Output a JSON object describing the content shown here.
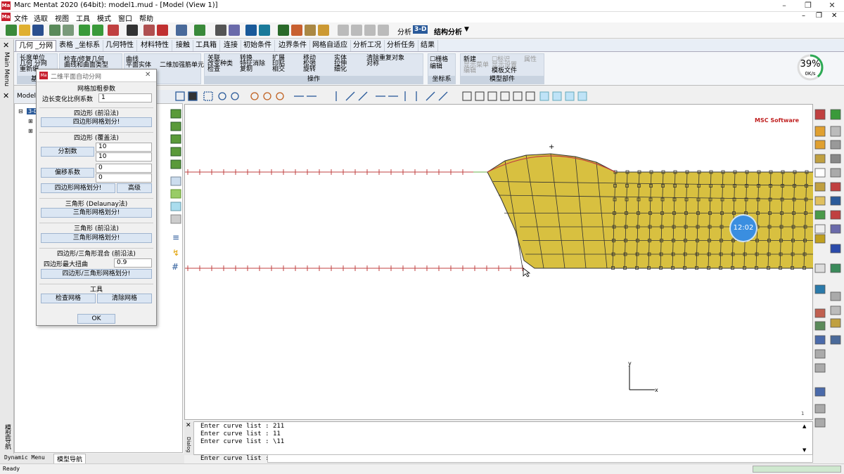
{
  "window": {
    "title": "Marc Mentat 2020 (64bit): model1.mud - [Model (View 1)]",
    "app_icon_text": "Ma"
  },
  "menu": [
    "文件",
    "选取",
    "视图",
    "工具",
    "模式",
    "窗口",
    "帮助"
  ],
  "toolbar": {
    "analysis_label": "分析",
    "analysis_value": "3-D",
    "structure_label": "结构分析"
  },
  "tabs": [
    "几何 _分网",
    "表格 _坐标系",
    "几何特性",
    "材料特性",
    "接触",
    "工具箱",
    "连接",
    "初始条件",
    "边界条件",
    "网格自适应",
    "分析工况",
    "分析任务",
    "结果"
  ],
  "ribbon": {
    "group1": {
      "lines": [
        "长度单位",
        "几何   分网",
        "重新编"
      ],
      "caption": "基本"
    },
    "group2": {
      "lines": [
        "检查/修复几何",
        "曲线和曲面类型"
      ],
      "caption": "分网"
    },
    "group3": {
      "lines": [
        "曲线",
        "平面实体",
        "二维加强筋单元"
      ],
      "caption": ""
    },
    "ops": {
      "col1": [
        "关联",
        "改变种类",
        "检查"
      ],
      "col2": [
        "转换",
        "特征消除",
        "复制"
      ],
      "col3": [
        "扩展",
        "印贴",
        "相交"
      ],
      "col4": [
        "移动",
        "松弛",
        "旋转"
      ],
      "col5": [
        "实体",
        "拉伸",
        "细化"
      ],
      "col6": [
        "清除重复对象",
        "对称"
      ],
      "caption": "操作"
    },
    "coord": {
      "lines": [
        "栅格",
        "编辑"
      ],
      "caption": "坐标系"
    },
    "model": {
      "col1": [
        "新建",
        "显示菜单",
        "编辑"
      ],
      "col2": [
        "标识",
        "显示设置",
        "模板文件"
      ],
      "col3": [
        "属性"
      ],
      "caption": "模型部件"
    }
  },
  "speed": {
    "percent": "39%",
    "rate": "0K/s",
    "fraction": 0.39
  },
  "left_strip": {
    "top": "Main Menu",
    "bottom": "模型导航"
  },
  "nav": {
    "head": "Model",
    "root": "3-D"
  },
  "mesher": {
    "title": "二维平面自动分网",
    "s_density": "网格加粗参数",
    "edge_ratio_label": "边长变化比例系数",
    "edge_ratio": "1",
    "s_quad_adv": "四边形 (前沿法)",
    "btn_quad_adv": "四边形网格划分!",
    "s_quad_over": "四边形 (覆盖法)",
    "div_label": "分割数",
    "div1": "10",
    "div2": "10",
    "off_label": "偏移系数",
    "off1": "0",
    "off2": "0",
    "btn_quad_over": "四边形网格划分!",
    "btn_adv": "高级",
    "s_tri_del": "三角形 (Delaunay法)",
    "btn_tri_del": "三角形网格划分!",
    "s_tri_adv": "三角形 (前沿法)",
    "btn_tri_adv": "三角形网格划分!",
    "s_mix": "四边形/三角形混合 (前沿法)",
    "warp_label": "四边形最大扭曲",
    "warp": "0.9",
    "btn_mix": "四边形/三角形网格划分!",
    "s_tools": "工具",
    "btn_check": "检查网格",
    "btn_clear": "清除网格",
    "ok": "OK"
  },
  "viewport": {
    "logo": "MSC Software",
    "timer": "12:02",
    "page": "1",
    "axis_x": "x",
    "axis_y": "y"
  },
  "dialog": {
    "label": "Dialog",
    "lines": [
      "Enter curve list :  211",
      "Enter curve list :  11",
      "Enter curve list :  \\11"
    ],
    "prompt": "Enter curve list :"
  },
  "bottom_tabs": [
    "Dynamic Menu",
    "模型导航"
  ],
  "status": "Ready"
}
